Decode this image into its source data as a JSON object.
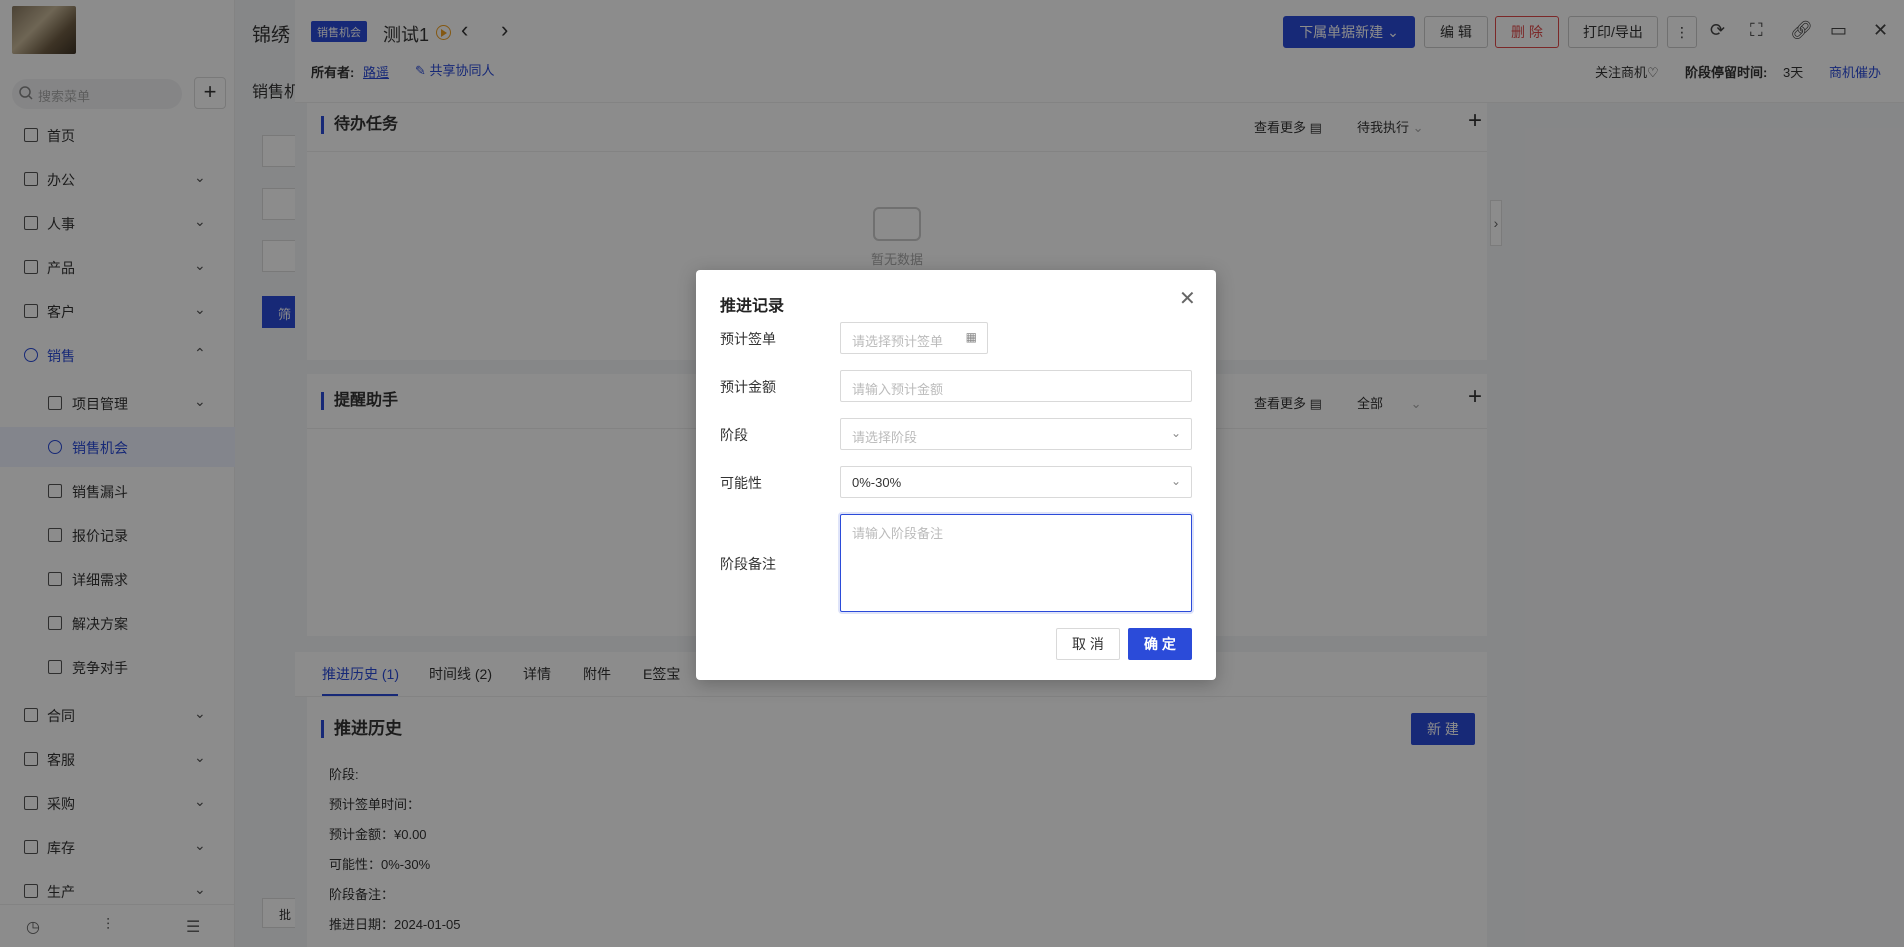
{
  "brand": "锦绣",
  "sidebar": {
    "search_placeholder": "搜索菜单",
    "items": [
      {
        "label": "首页",
        "icon": "home-icon"
      },
      {
        "label": "办公",
        "icon": "office-icon"
      },
      {
        "label": "人事",
        "icon": "people-icon"
      },
      {
        "label": "产品",
        "icon": "product-icon"
      },
      {
        "label": "客户",
        "icon": "customer-icon"
      },
      {
        "label": "销售",
        "icon": "sales-icon"
      },
      {
        "label": "项目管理",
        "icon": "project-icon"
      },
      {
        "label": "销售机会",
        "icon": "opportunity-icon"
      },
      {
        "label": "销售漏斗",
        "icon": "funnel-icon"
      },
      {
        "label": "报价记录",
        "icon": "quote-icon"
      },
      {
        "label": "详细需求",
        "icon": "requirement-icon"
      },
      {
        "label": "解决方案",
        "icon": "solution-icon"
      },
      {
        "label": "竞争对手",
        "icon": "competitor-icon"
      },
      {
        "label": "合同",
        "icon": "contract-icon"
      },
      {
        "label": "客服",
        "icon": "service-icon"
      },
      {
        "label": "采购",
        "icon": "purchase-icon"
      },
      {
        "label": "库存",
        "icon": "inventory-icon"
      },
      {
        "label": "生产",
        "icon": "production-icon"
      }
    ]
  },
  "bg_page": {
    "title": "销售机",
    "filter_button": "筛",
    "batch_button": "批"
  },
  "drawer": {
    "badge": "销售机会",
    "title": "测试1",
    "owner_label": "所有者:",
    "owner_value": "路遥",
    "share_label": "共享协同人",
    "buttons": {
      "sub_new": "下属单据新建",
      "edit": "编 辑",
      "delete": "删 除",
      "print": "打印/导出"
    },
    "follow_label": "关注商机",
    "stage_stay_label": "阶段停留时间:",
    "stage_stay_value": "3天",
    "remind_link": "商机催办",
    "todo": {
      "title": "待办任务",
      "more": "查看更多",
      "filter": "待我执行",
      "empty": "暂无数据"
    },
    "reminder": {
      "title": "提醒助手",
      "more": "查看更多",
      "filter": "全部"
    },
    "tabs": [
      "推进历史 (1)",
      "时间线 (2)",
      "详情",
      "附件",
      "E签宝"
    ],
    "history": {
      "title": "推进历史",
      "new_button": "新 建",
      "lines": [
        "阶段:",
        "预计签单时间：",
        "预计金额：¥0.00",
        "可能性：0%-30%",
        "阶段备注：",
        "推进日期：2024-01-05"
      ]
    }
  },
  "modal": {
    "title": "推进记录",
    "fields": {
      "sign_date": {
        "label": "预计签单",
        "placeholder": "请选择预计签单"
      },
      "amount": {
        "label": "预计金额",
        "placeholder": "请输入预计金额"
      },
      "stage": {
        "label": "阶段",
        "placeholder": "请选择阶段"
      },
      "probability": {
        "label": "可能性",
        "value": "0%-30%"
      },
      "remark": {
        "label": "阶段备注",
        "placeholder": "请输入阶段备注"
      }
    },
    "cancel": "取 消",
    "ok": "确 定"
  },
  "colors": {
    "accent": "#2b4bd9",
    "danger": "#e04a4a",
    "warning": "#f0a020"
  }
}
